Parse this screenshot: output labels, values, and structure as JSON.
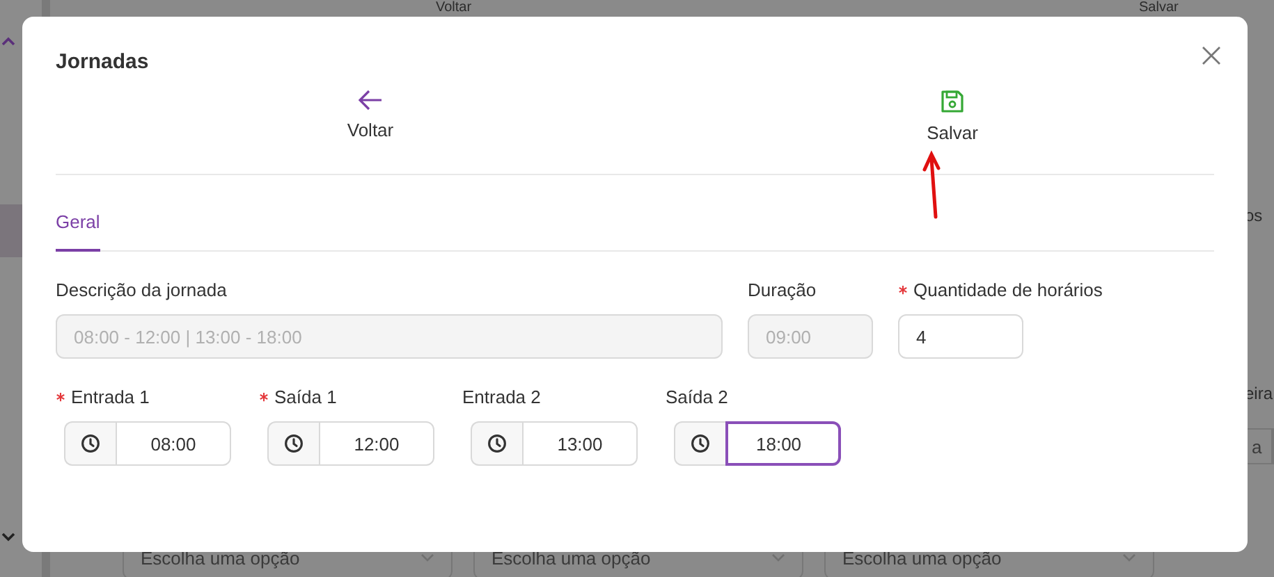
{
  "background": {
    "top_actions": [
      "Voltar",
      "Salvar"
    ],
    "side_texts": [
      "os",
      "eira"
    ],
    "side_field": {
      "placeholder": "a"
    },
    "dropdowns": [
      {
        "placeholder": "Escolha uma opção"
      },
      {
        "placeholder": "Escolha uma opção"
      },
      {
        "placeholder": "Escolha uma opção"
      }
    ]
  },
  "dialog": {
    "title": "Jornadas",
    "actions": [
      {
        "kind": "back",
        "label": "Voltar"
      },
      {
        "kind": "save",
        "label": "Salvar"
      }
    ],
    "tabs": [
      {
        "label": "Geral",
        "selected": true
      }
    ],
    "row_1": [
      {
        "kind": "long",
        "label": "Descrição da jornada",
        "required": false,
        "disabled": true,
        "value": "08:00 - 12:00 | 13:00 - 18:00"
      },
      {
        "kind": "short",
        "label": "Duração",
        "required": false,
        "disabled": true,
        "value": "09:00"
      },
      {
        "kind": "short",
        "label": "Quantidade de horários",
        "required": true,
        "disabled": false,
        "value": "4"
      }
    ],
    "row_2": [
      {
        "kind": "time",
        "label": "Entrada 1",
        "required": true,
        "focused": false,
        "value": "08:00"
      },
      {
        "kind": "time",
        "label": "Saída 1",
        "required": true,
        "focused": false,
        "value": "12:00"
      },
      {
        "kind": "time",
        "label": "Entrada 2",
        "required": false,
        "focused": false,
        "value": "13:00"
      },
      {
        "kind": "time",
        "label": "Saída 2",
        "required": false,
        "focused": true,
        "value": "18:00"
      }
    ]
  }
}
